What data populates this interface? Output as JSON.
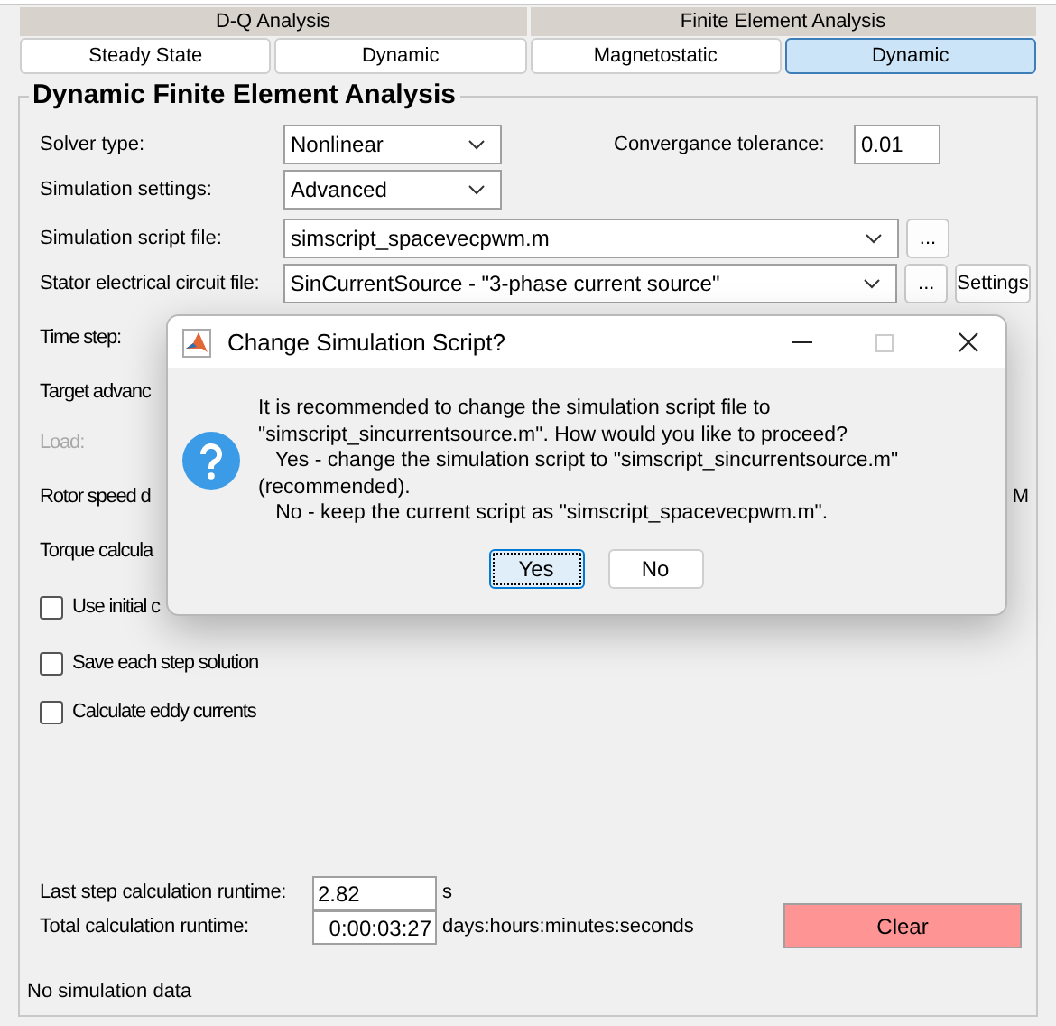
{
  "group_tabs": [
    {
      "label": "D-Q Analysis"
    },
    {
      "label": "Finite Element Analysis"
    }
  ],
  "tabs": [
    {
      "label": "Steady State",
      "selected": false
    },
    {
      "label": "Dynamic",
      "selected": false
    },
    {
      "label": "Magnetostatic",
      "selected": false
    },
    {
      "label": "Dynamic",
      "selected": true
    }
  ],
  "panel": {
    "title": "Dynamic Finite Element Analysis",
    "solver_type": {
      "label": "Solver type:",
      "value": "Nonlinear"
    },
    "convergence_tolerance": {
      "label": "Convergance tolerance:",
      "value": "0.01"
    },
    "simulation_settings": {
      "label": "Simulation settings:",
      "value": "Advanced"
    },
    "simulation_script_file": {
      "label": "Simulation script file:",
      "value": "simscript_spacevecpwm.m",
      "browse": "..."
    },
    "stator_circuit_file": {
      "label": "Stator electrical circuit file:",
      "value": "SinCurrentSource - \"3-phase current source\"",
      "browse": "...",
      "settings": "Settings"
    },
    "rows": [
      {
        "label": "Time step:",
        "disabled": false
      },
      {
        "label": "Target advanc",
        "disabled": false
      },
      {
        "label": "Load:",
        "disabled": true
      },
      {
        "label": "Rotor speed d",
        "disabled": false,
        "right": "M"
      },
      {
        "label": "Torque calcula",
        "disabled": false
      }
    ],
    "checkboxes": [
      {
        "label": "Use initial c",
        "checked": false
      },
      {
        "label": "Save each step solution",
        "checked": false
      },
      {
        "label": "Calculate eddy currents",
        "checked": false
      }
    ],
    "last_step_runtime": {
      "label": "Last step calculation runtime:",
      "value": "2.82",
      "unit": "s"
    },
    "total_runtime": {
      "label": "Total calculation runtime:",
      "value": "0:00:03:27",
      "unit": "days:hours:minutes:seconds"
    },
    "clear_button": "Clear",
    "status": "No simulation data"
  },
  "dialog": {
    "title": "Change Simulation Script?",
    "message": [
      "It is recommended to change the simulation script file to",
      "\"simscript_sincurrentsource.m\". How would you like to proceed?",
      "   Yes - change the simulation script to \"simscript_sincurrentsource.m\"",
      "(recommended).",
      "   No - keep the current script as \"simscript_spacevecpwm.m\"."
    ],
    "buttons": [
      {
        "label": "Yes",
        "selected": true
      },
      {
        "label": "No",
        "selected": false
      }
    ]
  }
}
